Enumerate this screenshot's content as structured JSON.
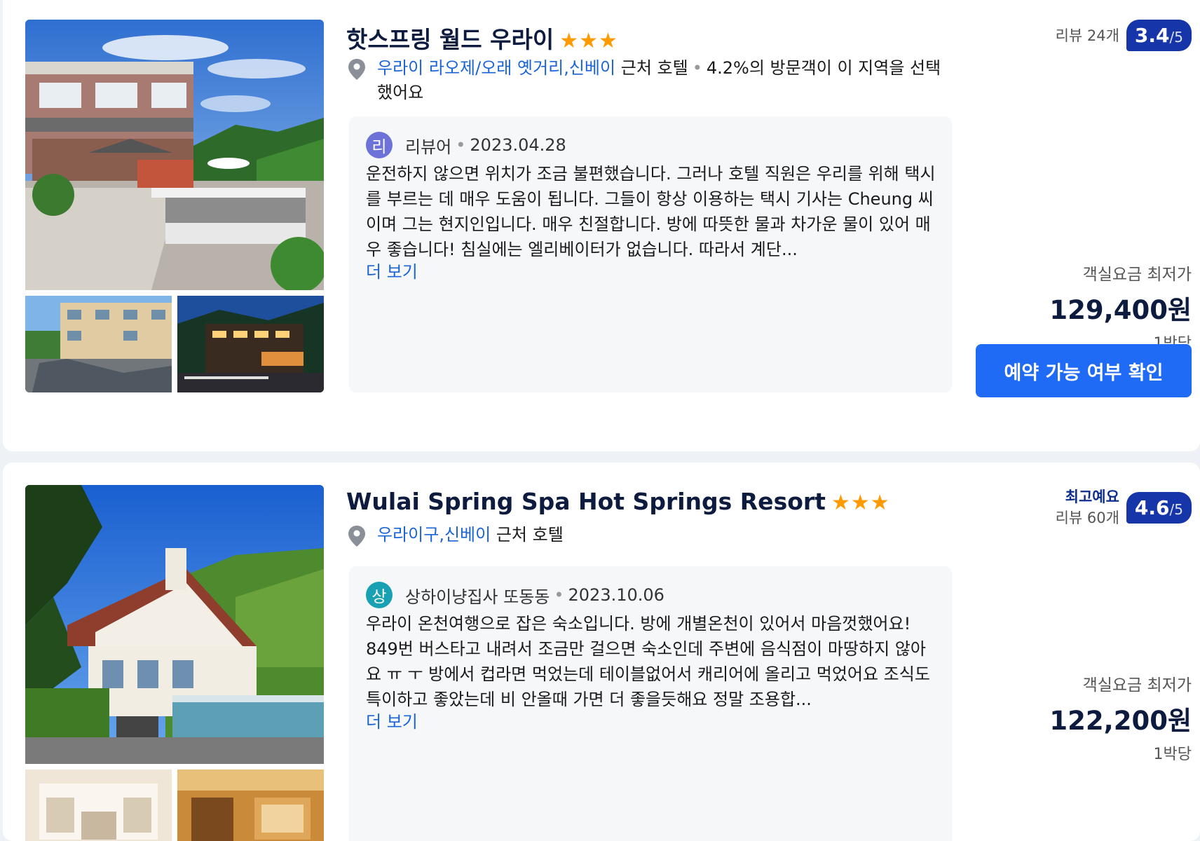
{
  "hotels": [
    {
      "name": "핫스프링 월드 우라이",
      "stars": "★★★",
      "location_link": "우라이 라오제/오래 옛거리,신베이",
      "location_suffix": "근처 호텔",
      "location_note": "4.2%의 방문객이 이 지역을 선택했어요",
      "review": {
        "avatar_letter": "리",
        "avatar_color": "#6c72d8",
        "reviewer": "리뷰어",
        "date": "2023.04.28",
        "text": "운전하지 않으면 위치가 조금 불편했습니다. 그러나 호텔 직원은 우리를 위해 택시를 부르는 데 매우 도움이 됩니다. 그들이 항상 이용하는 택시 기사는 Cheung 씨이며 그는 현지인입니다. 매우 친절합니다. 방에 따뜻한 물과 차가운 물이 있어 매우 좋습니다! 침실에는 엘리베이터가 없습니다. 따라서 계단...",
        "more": "더 보기"
      },
      "badge_label": "",
      "reviews_count": "리뷰 24개",
      "score": "3.4",
      "score_den": "/5",
      "price_label": "객실요금 최저가",
      "price": "129,400원",
      "per_night": "1박당",
      "cta": "예약 가능 여부 확인"
    },
    {
      "name": "Wulai Spring Spa Hot Springs Resort",
      "stars": "★★★",
      "location_link": "우라이구,신베이",
      "location_suffix": "근처 호텔",
      "location_note": "",
      "review": {
        "avatar_letter": "상",
        "avatar_color": "#1aa0b3",
        "reviewer": "상하이냥집사 또동동",
        "date": "2023.10.06",
        "text": "우라이 온천여행으로 잡은 숙소입니다. 방에 개별온천이 있어서 마음껏했어요! 849번 버스타고 내려서 조금만 걸으면 숙소인데 주변에 음식점이 마땅하지 않아요 ㅠ ㅜ 방에서 컵라면 먹었는데 테이블없어서 캐리어에 올리고 먹었어요 조식도 특이하고 좋았는데 비 안올때 가면 더 좋을듯해요 정말 조용합...",
        "more": "더 보기"
      },
      "badge_label": "최고예요",
      "reviews_count": "리뷰 60개",
      "score": "4.6",
      "score_den": "/5",
      "price_label": "객실요금 최저가",
      "price": "122,200원",
      "per_night": "1박당"
    }
  ],
  "colors": {
    "accent_blue": "#1f6bf5",
    "link_blue": "#1a64d6",
    "score_badge": "#1535a8",
    "star_orange": "#ff9a00"
  }
}
